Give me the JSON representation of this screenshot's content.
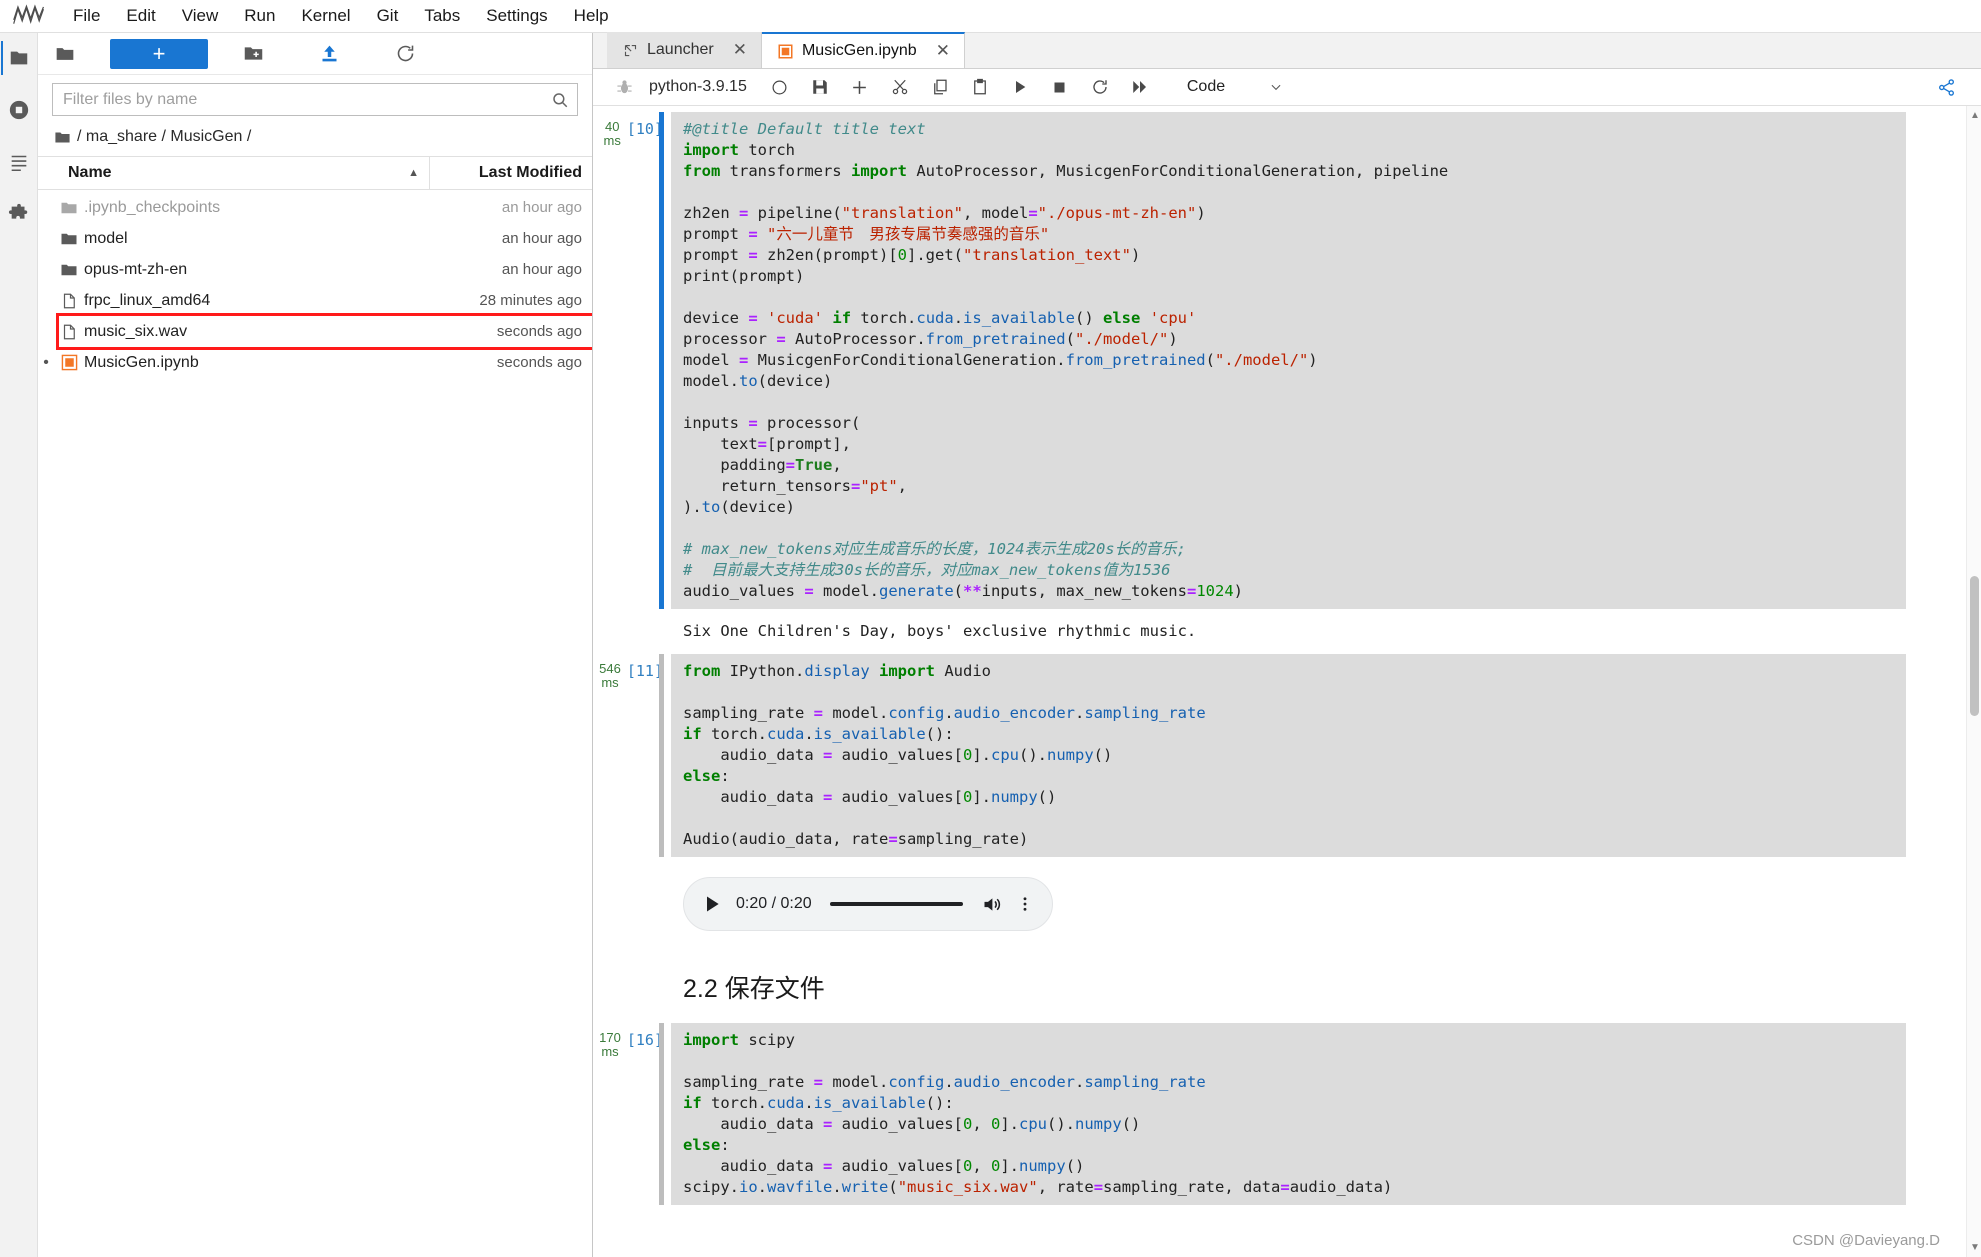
{
  "menubar": {
    "logo_name": "jupyter-logo",
    "items": [
      "File",
      "Edit",
      "View",
      "Run",
      "Kernel",
      "Git",
      "Tabs",
      "Settings",
      "Help"
    ]
  },
  "rail": {
    "items": [
      {
        "name": "file-browser",
        "icon": "folder-icon"
      },
      {
        "name": "running-terminals",
        "icon": "stop-circle-icon"
      },
      {
        "name": "table-of-contents",
        "icon": "list-icon"
      },
      {
        "name": "extension-manager",
        "icon": "puzzle-icon"
      }
    ]
  },
  "filebrowser": {
    "toolbar": {
      "folder_icon": "folder-icon",
      "new_launcher_label": "+",
      "new_folder_icon": "new-folder-icon",
      "upload_icon": "upload-icon",
      "refresh_icon": "refresh-icon"
    },
    "filter": {
      "placeholder": "Filter files by name",
      "value": "",
      "search_icon": "search-icon"
    },
    "breadcrumb": "/ ma_share / MusicGen /",
    "columns": {
      "name": "Name",
      "last_modified": "Last Modified",
      "sort_caret": "▲"
    },
    "rows": [
      {
        "name": ".ipynb_checkpoints",
        "modified": "an hour ago",
        "kind": "folder",
        "muted": true,
        "highlight": false,
        "dirty": false
      },
      {
        "name": "model",
        "modified": "an hour ago",
        "kind": "folder",
        "muted": false,
        "highlight": false,
        "dirty": false
      },
      {
        "name": "opus-mt-zh-en",
        "modified": "an hour ago",
        "kind": "folder",
        "muted": false,
        "highlight": false,
        "dirty": false
      },
      {
        "name": "frpc_linux_amd64",
        "modified": "28 minutes ago",
        "kind": "file",
        "muted": false,
        "highlight": false,
        "dirty": false
      },
      {
        "name": "music_six.wav",
        "modified": "seconds ago",
        "kind": "file",
        "muted": false,
        "highlight": true,
        "dirty": false
      },
      {
        "name": "MusicGen.ipynb",
        "modified": "seconds ago",
        "kind": "notebook",
        "muted": false,
        "highlight": false,
        "dirty": true
      }
    ]
  },
  "tabs": [
    {
      "label": "Launcher",
      "icon": "launcher-icon",
      "active": false,
      "closable": true
    },
    {
      "label": "MusicGen.ipynb",
      "icon": "notebook-icon",
      "active": true,
      "closable": true
    }
  ],
  "notebook_toolbar": {
    "debug_icon": "bug-icon",
    "kernel_name": "python-3.9.15",
    "kernel_status_icon": "kernel-idle-circle-icon",
    "save_icon": "save-icon",
    "insert_icon": "add-cell-icon",
    "cut_icon": "cut-icon",
    "copy_icon": "copy-icon",
    "paste_icon": "paste-icon",
    "run_icon": "run-icon",
    "stop_icon": "stop-icon",
    "restart_icon": "restart-icon",
    "restart_run_all_icon": "restart-run-all-icon",
    "celltype_value": "Code",
    "celltype_caret": "⌄",
    "share_icon": "share-icon"
  },
  "cells": [
    {
      "exec_time": "40",
      "exec_unit": "ms",
      "exec_count": "[10]",
      "selected": true,
      "output_text": "Six One Children's Day, boys' exclusive rhythmic music."
    },
    {
      "exec_time": "546",
      "exec_unit": "ms",
      "exec_count": "[11]",
      "selected": false,
      "output_text": ""
    },
    {
      "exec_time": "170",
      "exec_unit": "ms",
      "exec_count": "[16]",
      "selected": false,
      "output_text": ""
    }
  ],
  "audio_player": {
    "play_icon": "play-icon",
    "time_display": "0:20 / 0:20",
    "volume_icon": "volume-icon",
    "more_icon": "more-options-icon"
  },
  "markdown_cell": {
    "heading": "2.2 保存文件"
  },
  "cell_toolbar": {
    "add_icon": "add-icon",
    "move_up_icon": "chevron-up-icon",
    "move_down_icon": "chevron-down-icon",
    "delete_icon": "trash-icon"
  },
  "watermark": "CSDN @Davieyang.D",
  "colors": {
    "accent": "#1976d2",
    "highlight_box": "#ff1a1a",
    "code_bg": "#dcdcdc",
    "notebook_orange": "#f37726"
  }
}
